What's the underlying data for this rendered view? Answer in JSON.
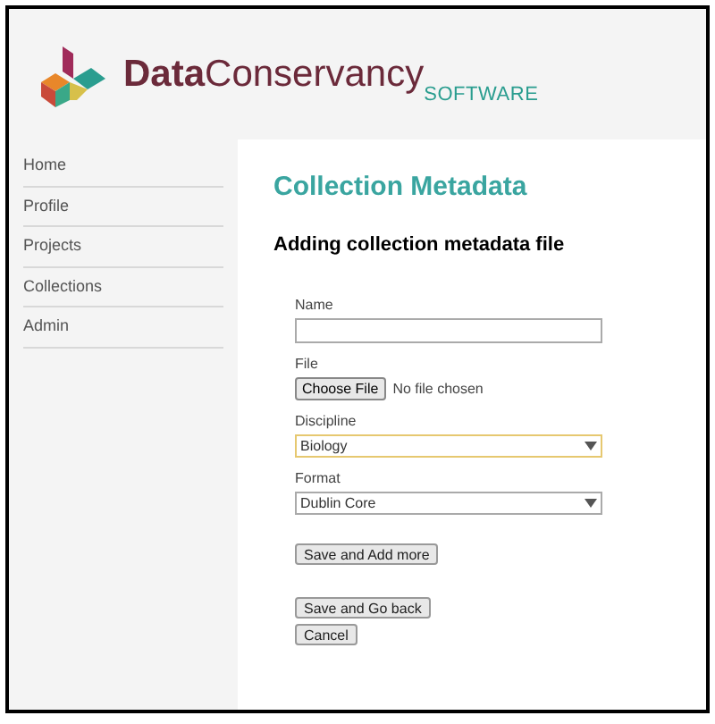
{
  "header": {
    "brand_bold": "Data",
    "brand_rest": "Conservancy",
    "brand_sub": "SOFTWARE"
  },
  "sidebar": {
    "items": [
      {
        "label": "Home"
      },
      {
        "label": "Profile"
      },
      {
        "label": "Projects"
      },
      {
        "label": "Collections"
      },
      {
        "label": "Admin"
      }
    ]
  },
  "main": {
    "title": "Collection Metadata",
    "subtitle": "Adding collection metadata file",
    "fields": [
      {
        "kind": "text",
        "label": "Name"
      },
      {
        "kind": "file",
        "label": "File",
        "button": "Choose File",
        "status": "No file chosen"
      },
      {
        "kind": "select",
        "label": "Discipline",
        "value": "Biology",
        "focused": true
      },
      {
        "kind": "select",
        "label": "Format",
        "value": "Dublin Core",
        "focused": false
      }
    ],
    "button_groups": [
      [
        "Save and Add more"
      ],
      [
        "Save and Go back",
        "Cancel"
      ]
    ]
  }
}
